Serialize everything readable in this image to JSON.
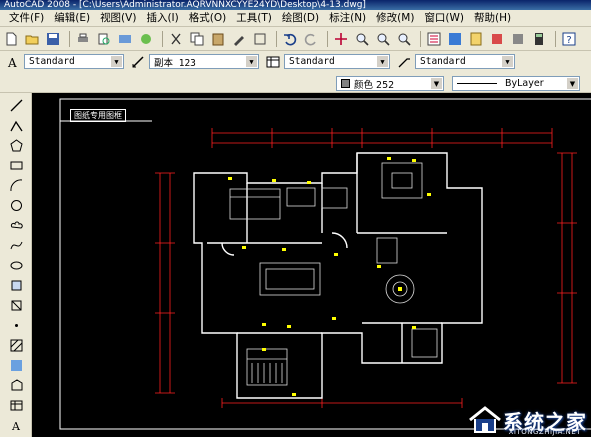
{
  "window": {
    "title": "AutoCAD 2008 - [C:\\Users\\Administrator.AQRVNNXCYYE24YD\\Desktop\\4-13.dwg]"
  },
  "menu": [
    {
      "label": "文件(F)"
    },
    {
      "label": "编辑(E)"
    },
    {
      "label": "视图(V)"
    },
    {
      "label": "插入(I)"
    },
    {
      "label": "格式(O)"
    },
    {
      "label": "工具(T)"
    },
    {
      "label": "绘图(D)"
    },
    {
      "label": "标注(N)"
    },
    {
      "label": "修改(M)"
    },
    {
      "label": "窗口(W)"
    },
    {
      "label": "帮助(H)"
    }
  ],
  "styles": {
    "text_style": "Standard",
    "dim_style": "副本 123",
    "table_style": "Standard",
    "multileader_style": "Standard"
  },
  "properties": {
    "color": "颜色 252",
    "linetype": "ByLayer"
  },
  "drawing": {
    "frame_label": "图纸专用图框"
  },
  "watermark": {
    "text": "系统之家",
    "url": "XITONGZHIJIA.NET"
  },
  "colors": {
    "canvas": "#000000",
    "wall": "#ffffff",
    "dimension": "#ff2020",
    "furniture": "#e0e0e0",
    "marker": "#ffff00",
    "titlebar": "#0a246a"
  }
}
